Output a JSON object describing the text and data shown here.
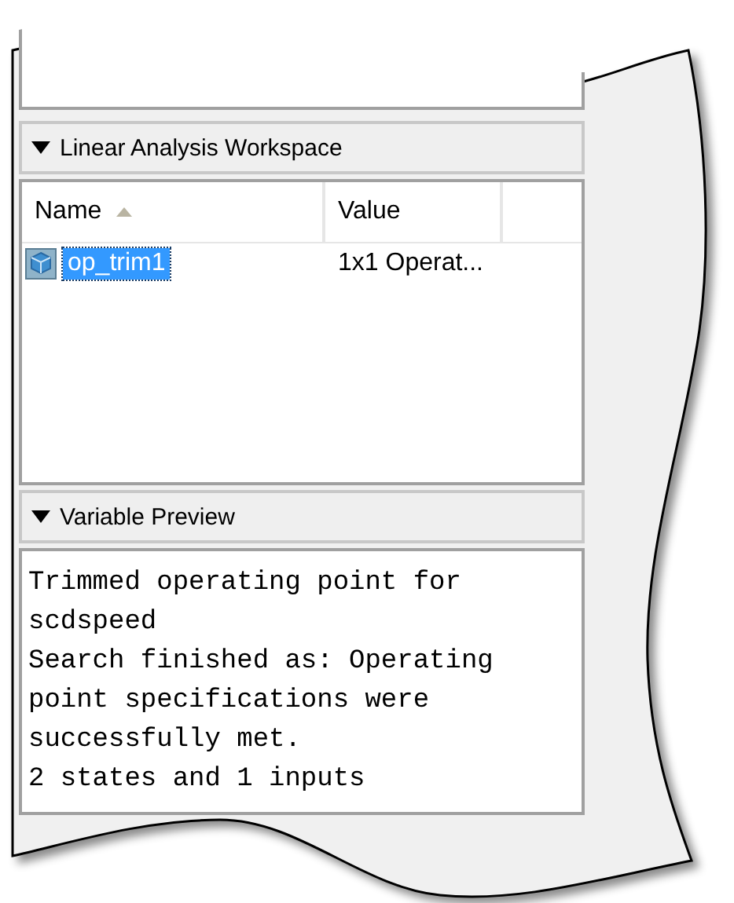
{
  "workspace": {
    "title": "Linear Analysis Workspace",
    "expanded": true,
    "columns": [
      {
        "label": "Name",
        "sorted": true
      },
      {
        "label": "Value",
        "sorted": false
      }
    ],
    "rows": [
      {
        "name": "op_trim1",
        "value": "1x1 Operat...",
        "selected": true
      }
    ]
  },
  "preview": {
    "title": "Variable Preview",
    "expanded": true,
    "lines": [
      "Trimmed operating point for",
      "scdspeed",
      "Search finished as: Operating",
      "point specifications were",
      "successfully met.",
      "2 states and 1 inputs"
    ]
  }
}
